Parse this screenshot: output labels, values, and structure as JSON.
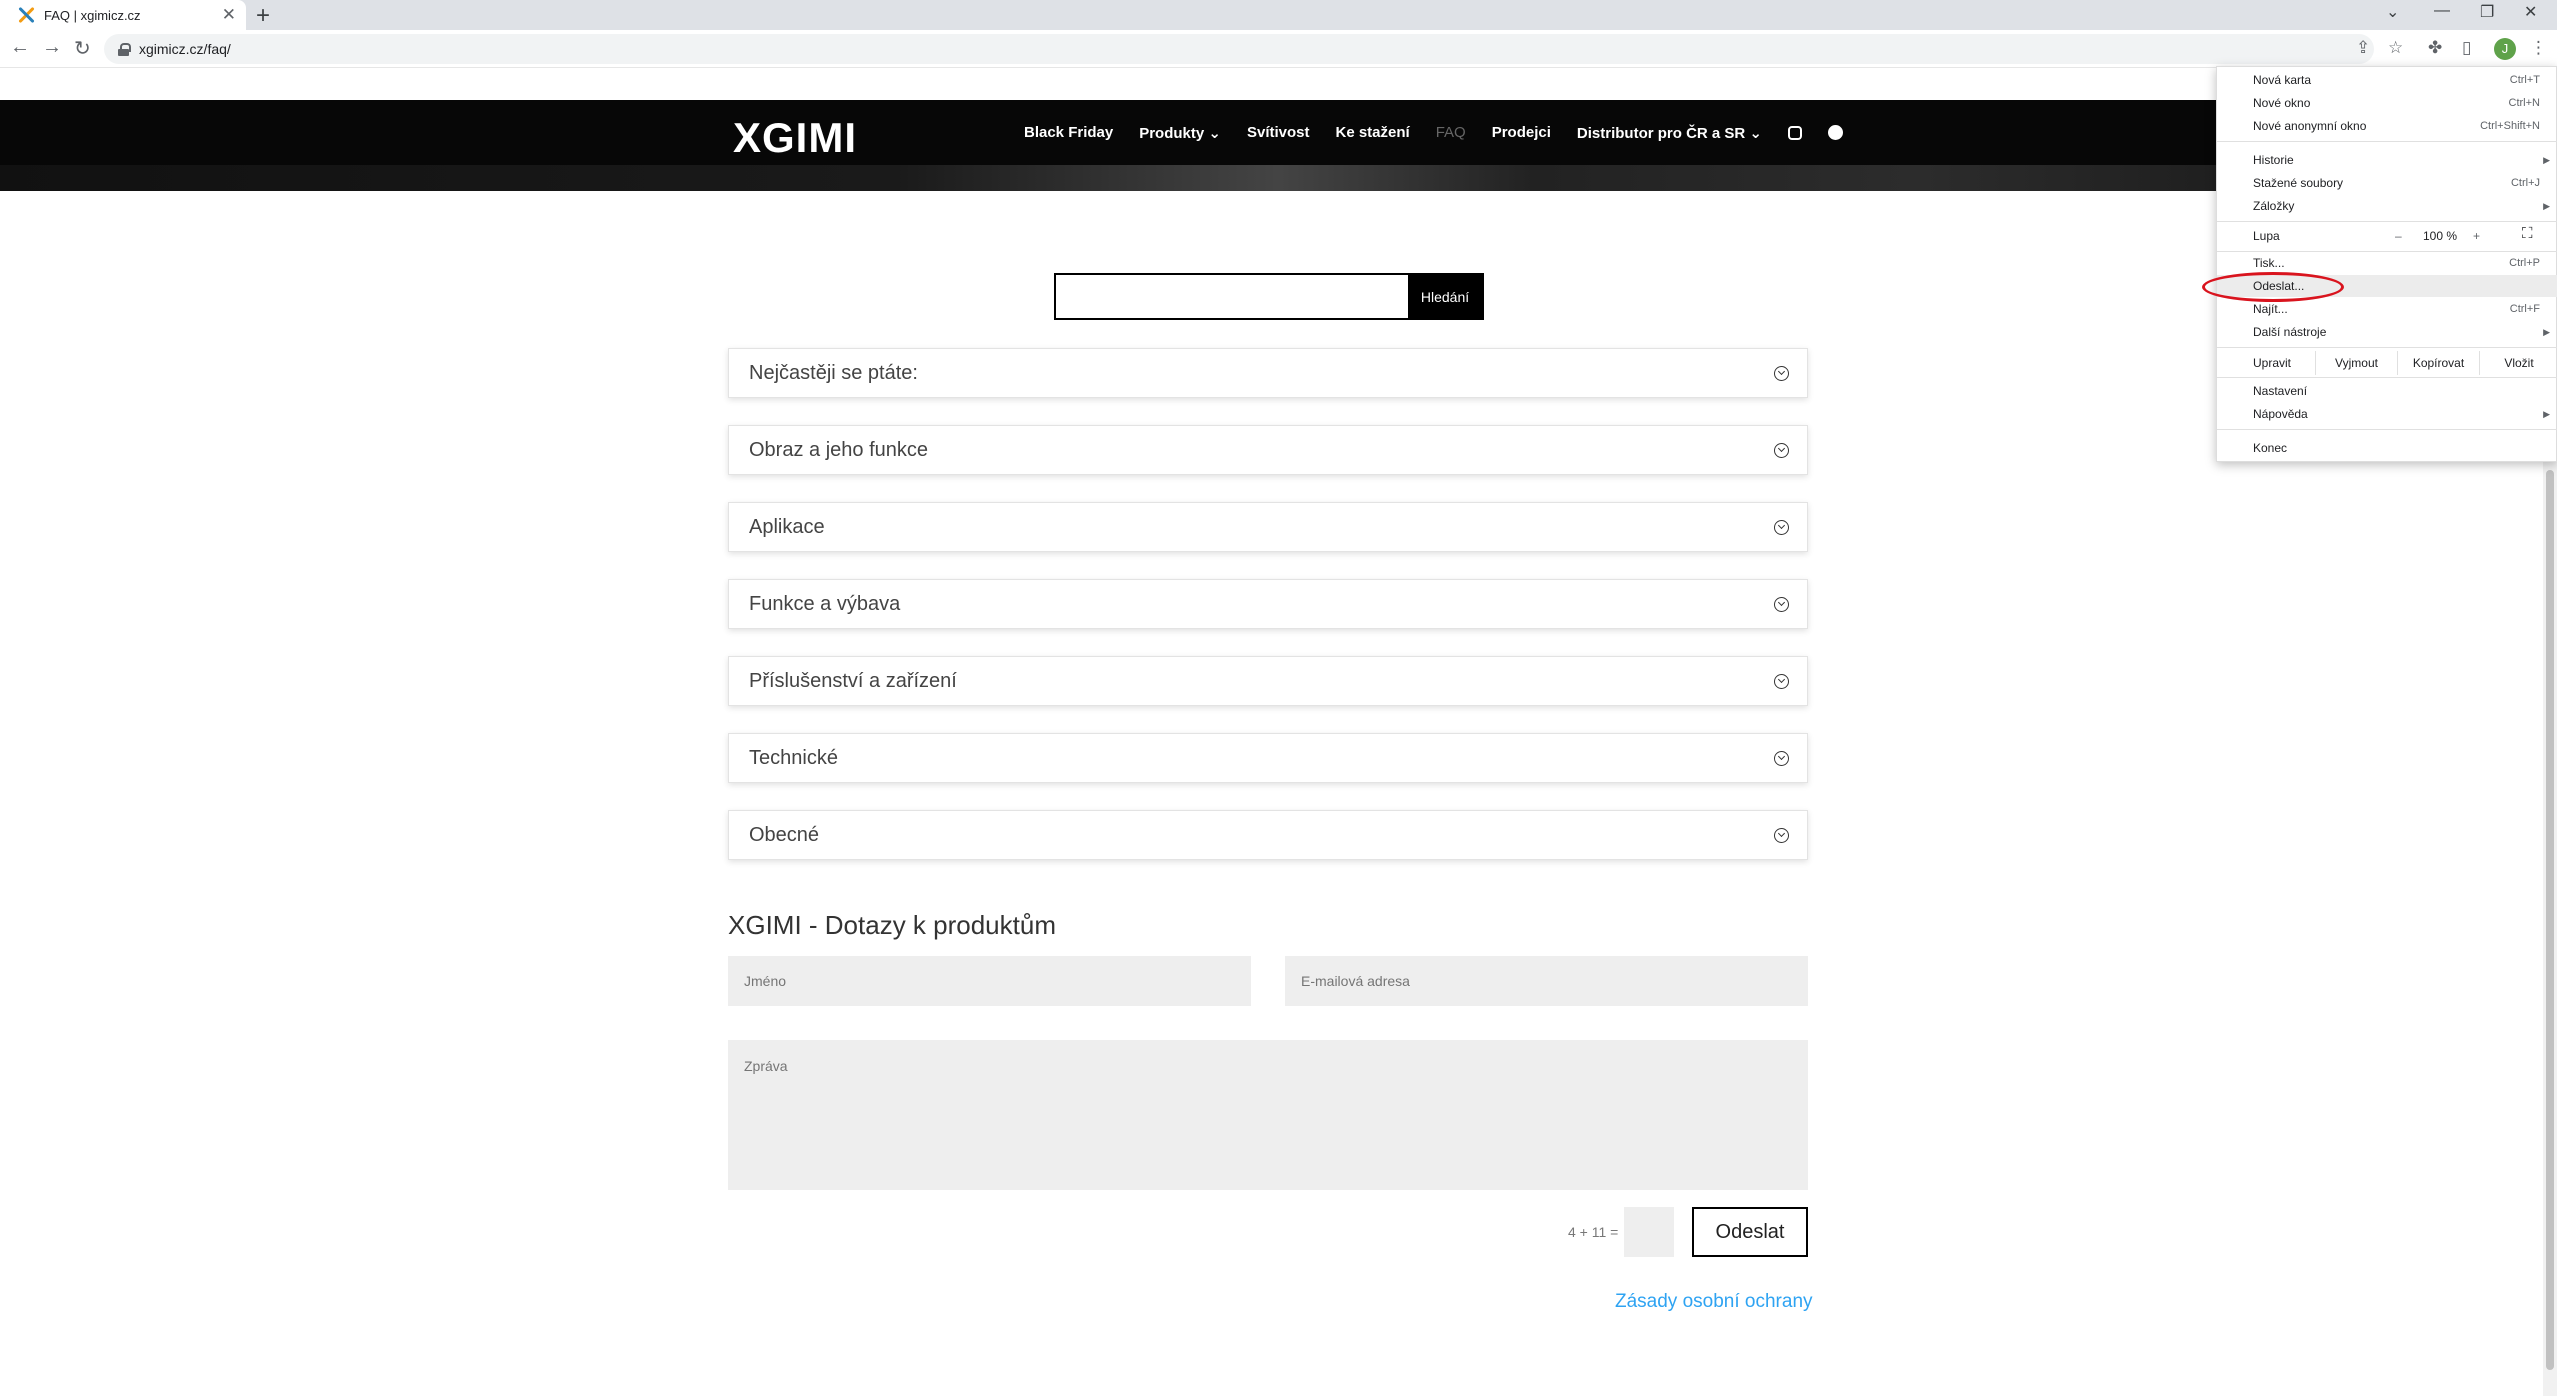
{
  "browser": {
    "tab_title": "FAQ | xgimicz.cz",
    "url": "xgimicz.cz/faq/",
    "avatar_letter": "J"
  },
  "site": {
    "logo": "XGIMI",
    "nav": [
      {
        "label": "Black Friday"
      },
      {
        "label": "Produkty ⌄"
      },
      {
        "label": "Svítivost"
      },
      {
        "label": "Ke stažení"
      },
      {
        "label": "FAQ"
      },
      {
        "label": "Prodejci"
      },
      {
        "label": "Distributor pro ČR a SR ⌄"
      }
    ],
    "search_button": "Hledání"
  },
  "faq": {
    "sections": [
      {
        "title": "Nejčastěji se ptáte:"
      },
      {
        "title": "Obraz a jeho funkce"
      },
      {
        "title": "Aplikace"
      },
      {
        "title": "Funkce a výbava"
      },
      {
        "title": "Příslušenství a zařízení"
      },
      {
        "title": "Technické"
      },
      {
        "title": "Obecné"
      }
    ]
  },
  "form": {
    "title": "XGIMI - Dotazy k produktům",
    "name_placeholder": "Jméno",
    "email_placeholder": "E-mailová adresa",
    "message_placeholder": "Zpráva",
    "captcha": "4 + 11 =",
    "submit": "Odeslat",
    "privacy": "Zásady osobní ochrany"
  },
  "menu": {
    "items": [
      {
        "label": "Nová karta",
        "shortcut": "Ctrl+T"
      },
      {
        "label": "Nové okno",
        "shortcut": "Ctrl+N"
      },
      {
        "label": "Nové anonymní okno",
        "shortcut": "Ctrl+Shift+N"
      },
      {
        "label": "Historie",
        "shortcut": ""
      },
      {
        "label": "Stažené soubory",
        "shortcut": "Ctrl+J"
      },
      {
        "label": "Záložky",
        "shortcut": ""
      },
      {
        "label": "Tisk...",
        "shortcut": "Ctrl+P"
      },
      {
        "label": "Odeslat...",
        "shortcut": ""
      },
      {
        "label": "Najít...",
        "shortcut": "Ctrl+F"
      },
      {
        "label": "Další nástroje",
        "shortcut": ""
      },
      {
        "label": "Nastavení",
        "shortcut": ""
      },
      {
        "label": "Nápověda",
        "shortcut": ""
      },
      {
        "label": "Konec",
        "shortcut": ""
      }
    ],
    "zoom_label": "Lupa",
    "zoom_minus": "–",
    "zoom_value": "100 %",
    "zoom_plus": "+",
    "edit_label": "Upravit",
    "cut": "Vyjmout",
    "copy": "Kopírovat",
    "paste": "Vložit"
  }
}
